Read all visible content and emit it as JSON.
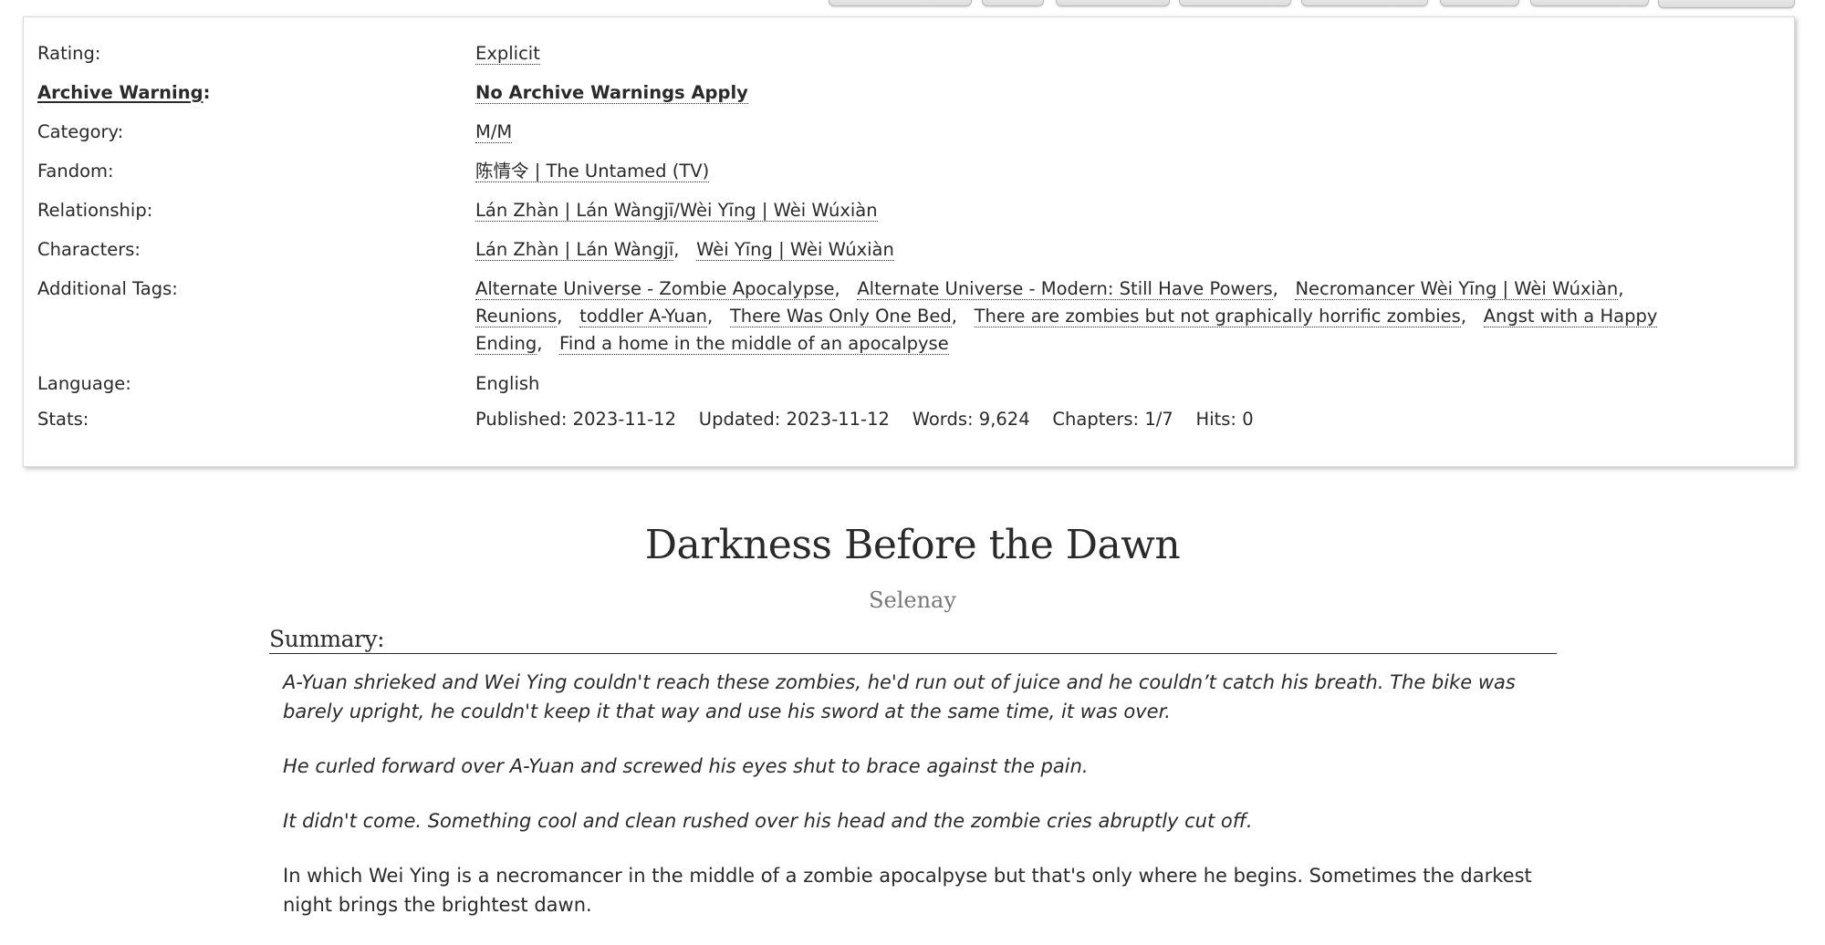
{
  "top_buttons": [
    {
      "label": ""
    },
    {
      "label": ""
    },
    {
      "label": ""
    },
    {
      "label": ""
    },
    {
      "label": ""
    },
    {
      "label": ""
    },
    {
      "label": ""
    },
    {
      "label": ""
    }
  ],
  "meta": {
    "rating": {
      "label": "Rating:",
      "tags": [
        "Explicit"
      ]
    },
    "archive_warning": {
      "label": "Archive Warning",
      "colon": ":",
      "tags": [
        "No Archive Warnings Apply"
      ]
    },
    "category": {
      "label": "Category:",
      "tags": [
        "M/M"
      ]
    },
    "fandom": {
      "label": "Fandom:",
      "tags": [
        "陈情令 | The Untamed (TV)"
      ]
    },
    "relationship": {
      "label": "Relationship:",
      "tags": [
        "Lán Zhàn | Lán Wàngjī/Wèi Yīng | Wèi Wúxiàn"
      ]
    },
    "characters": {
      "label": "Characters:",
      "tags": [
        "Lán Zhàn | Lán Wàngjī",
        "Wèi Yīng | Wèi Wúxiàn"
      ]
    },
    "additional_tags": {
      "label": "Additional Tags:",
      "tags": [
        "Alternate Universe - Zombie Apocalypse",
        "Alternate Universe - Modern: Still Have Powers",
        "Necromancer Wèi Yīng | Wèi Wúxiàn",
        "Reunions",
        "toddler A-Yuan",
        "There Was Only One Bed",
        "There are zombies but not graphically horrific zombies",
        "Angst with a Happy Ending",
        "Find a home in the middle of an apocalpyse"
      ]
    },
    "language": {
      "label": "Language:",
      "value": "English"
    },
    "stats": {
      "label": "Stats:",
      "published_label": "Published:",
      "published": "2023-11-12",
      "updated_label": "Updated:",
      "updated": "2023-11-12",
      "words_label": "Words:",
      "words": "9,624",
      "chapters_label": "Chapters:",
      "chapters": "1/7",
      "hits_label": "Hits:",
      "hits": "0"
    }
  },
  "work": {
    "title": "Darkness Before the Dawn",
    "author": "Selenay",
    "summary_heading": "Summary:",
    "summary": [
      {
        "italic": true,
        "text": "A-Yuan shrieked and Wei Ying couldn't reach these zombies, he'd run out of juice and he couldn’t catch his breath. The bike was barely upright, he couldn't keep it that way and use his sword at the same time, it was over."
      },
      {
        "italic": true,
        "text": "He curled forward over A-Yuan and screwed his eyes shut to brace against the pain."
      },
      {
        "italic": true,
        "text": "It didn't come. Something cool and clean rushed over his head and the zombie cries abruptly cut off."
      },
      {
        "italic": false,
        "text": "In which Wei Ying is a necromancer in the middle of a zombie apocalpyse but that's only where he begins. Sometimes the darkest night brings the brightest dawn."
      }
    ]
  }
}
